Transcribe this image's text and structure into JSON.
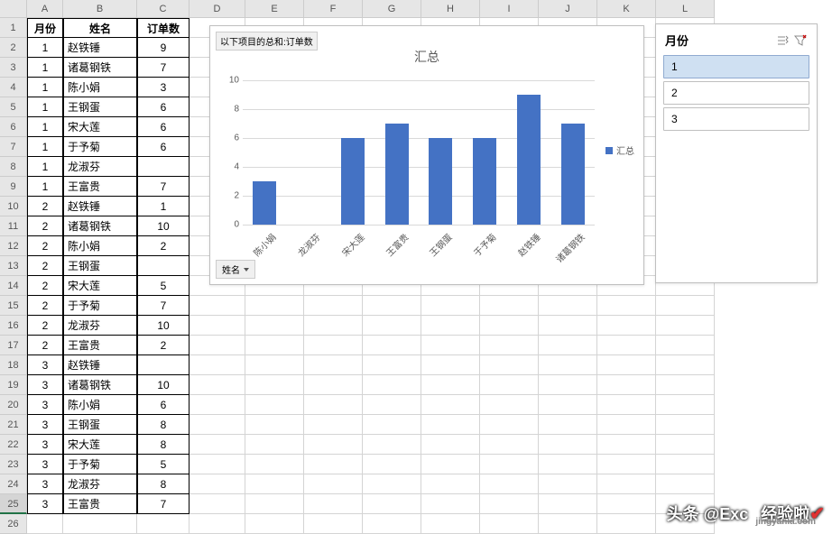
{
  "columns": [
    "A",
    "B",
    "C",
    "D",
    "E",
    "F",
    "G",
    "H",
    "I",
    "J",
    "K",
    "L"
  ],
  "headers": {
    "A": "月份",
    "B": "姓名",
    "C": "订单数"
  },
  "rows": [
    {
      "A": "1",
      "B": "赵铁锤",
      "C": "9"
    },
    {
      "A": "1",
      "B": "诸葛钢铁",
      "C": "7"
    },
    {
      "A": "1",
      "B": "陈小娟",
      "C": "3"
    },
    {
      "A": "1",
      "B": "王钢蛋",
      "C": "6"
    },
    {
      "A": "1",
      "B": "宋大莲",
      "C": "6"
    },
    {
      "A": "1",
      "B": "于予菊",
      "C": "6"
    },
    {
      "A": "1",
      "B": "龙淑芬",
      "C": ""
    },
    {
      "A": "1",
      "B": "王富贵",
      "C": "7"
    },
    {
      "A": "2",
      "B": "赵铁锤",
      "C": "1"
    },
    {
      "A": "2",
      "B": "诸葛钢铁",
      "C": "10"
    },
    {
      "A": "2",
      "B": "陈小娟",
      "C": "2"
    },
    {
      "A": "2",
      "B": "王钢蛋",
      "C": ""
    },
    {
      "A": "2",
      "B": "宋大莲",
      "C": "5"
    },
    {
      "A": "2",
      "B": "于予菊",
      "C": "7"
    },
    {
      "A": "2",
      "B": "龙淑芬",
      "C": "10"
    },
    {
      "A": "2",
      "B": "王富贵",
      "C": "2"
    },
    {
      "A": "3",
      "B": "赵铁锤",
      "C": ""
    },
    {
      "A": "3",
      "B": "诸葛钢铁",
      "C": "10"
    },
    {
      "A": "3",
      "B": "陈小娟",
      "C": "6"
    },
    {
      "A": "3",
      "B": "王钢蛋",
      "C": "8"
    },
    {
      "A": "3",
      "B": "宋大莲",
      "C": "8"
    },
    {
      "A": "3",
      "B": "于予菊",
      "C": "5"
    },
    {
      "A": "3",
      "B": "龙淑芬",
      "C": "8"
    },
    {
      "A": "3",
      "B": "王富贵",
      "C": "7"
    }
  ],
  "selected_row": 25,
  "chart_data": {
    "type": "bar",
    "field_label": "以下项目的总和:订单数",
    "title": "汇总",
    "categories": [
      "陈小娟",
      "龙淑芬",
      "宋大莲",
      "王富贵",
      "王钢蛋",
      "于予菊",
      "赵铁锤",
      "诸葛钢铁"
    ],
    "values": [
      3,
      0,
      6,
      7,
      6,
      6,
      9,
      7
    ],
    "ylim": [
      0,
      10
    ],
    "yticks": [
      0,
      2,
      4,
      6,
      8,
      10
    ],
    "legend": "汇总",
    "axis_filter": "姓名"
  },
  "slicer": {
    "title": "月份",
    "items": [
      "1",
      "2",
      "3"
    ],
    "selected": "1"
  },
  "watermark": {
    "left": "头条 @Exc",
    "right": "经验啦",
    "site": "jingyanla.com"
  }
}
